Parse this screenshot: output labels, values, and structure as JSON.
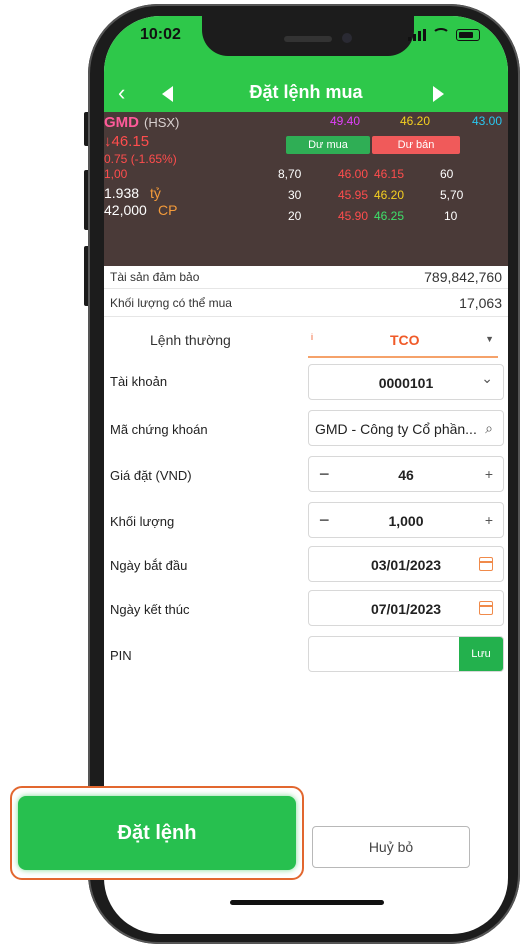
{
  "status": {
    "time": "10:02"
  },
  "header": {
    "title": "Đặt lệnh mua",
    "back": "‹"
  },
  "market": {
    "symbol": "GMD",
    "exchange": "(HSX)",
    "price": "↓46.15",
    "change": "0.75 (-1.65%)",
    "ratio": "1,00",
    "value": "1.938",
    "value_unit": "tỷ",
    "volume": "42,000",
    "volume_unit": "CP",
    "ceiling": "49.40",
    "reference": "46.20",
    "floor": "43.00",
    "bid_label": "Dư mua",
    "ask_label": "Dư bán",
    "book": [
      {
        "bid_vol": "8,70",
        "bid": "46.00",
        "ask": "46.15",
        "ask_vol": "60"
      },
      {
        "bid_vol": "30",
        "bid": "45.95",
        "ask": "46.20",
        "ask_vol": "5,70"
      },
      {
        "bid_vol": "20",
        "bid": "45.90",
        "ask": "46.25",
        "ask_vol": "10"
      }
    ]
  },
  "account_info": {
    "collateral_label": "Tài sản đảm bảo",
    "collateral_value": "789,842,760",
    "buyable_label": "Khối lượng có thể mua",
    "buyable_value": "17,063"
  },
  "order_tabs": {
    "normal": "Lệnh thường",
    "tco": "TCO",
    "info_icon": "i",
    "caret": "▼"
  },
  "form": {
    "account_label": "Tài khoản",
    "account_value": "0000101",
    "symbol_label": "Mã chứng khoán",
    "symbol_value": "GMD - Công ty Cổ phần...",
    "price_label": "Giá đặt (VND)",
    "price_value": "46",
    "qty_label": "Khối lượng",
    "qty_value": "1,000",
    "start_label": "Ngày bắt đầu",
    "start_value": "03/01/2023",
    "end_label": "Ngày kết thúc",
    "end_value": "07/01/2023",
    "pin_label": "PIN",
    "pin_value": "",
    "save_label": "Lưu",
    "minus": "−",
    "plus": "+",
    "dropdown": "⌄",
    "search": "⌕"
  },
  "actions": {
    "submit": "Đặt lệnh",
    "cancel": "Huỷ bỏ"
  },
  "colors": {
    "brand_green": "#2ec84a",
    "panel_brown": "#4a3a38",
    "accent_orange": "#f05a28",
    "ceiling_purple": "#e040fb",
    "ref_yellow": "#f5d020",
    "floor_cyan": "#29c7f0",
    "down_red": "#ff4d4d",
    "up_green": "#3ee06a"
  }
}
